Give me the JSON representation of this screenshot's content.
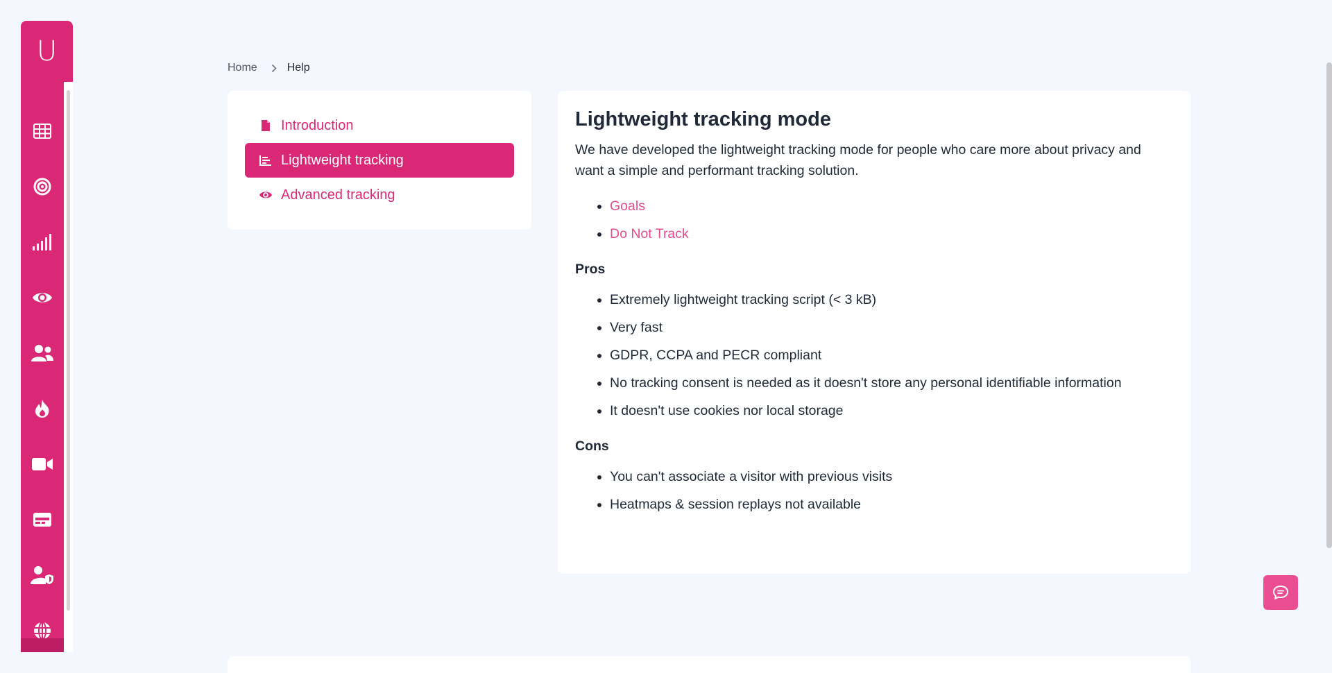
{
  "sidebar": {
    "logo_letter": "U",
    "items": [
      {
        "icon": "grid-icon"
      },
      {
        "icon": "target-icon"
      },
      {
        "icon": "signal-bars-icon"
      },
      {
        "icon": "eye-icon"
      },
      {
        "icon": "users-icon"
      },
      {
        "icon": "fire-icon"
      },
      {
        "icon": "video-camera-icon"
      },
      {
        "icon": "card-icon"
      },
      {
        "icon": "user-shield-icon"
      },
      {
        "icon": "globe-icon"
      }
    ]
  },
  "breadcrumb": {
    "home": "Home",
    "current": "Help"
  },
  "help_nav": {
    "items": [
      {
        "label": "Introduction",
        "icon": "file-icon",
        "active": false
      },
      {
        "label": "Lightweight tracking",
        "icon": "chart-icon",
        "active": true
      },
      {
        "label": "Advanced tracking",
        "icon": "eye-icon",
        "active": false
      }
    ]
  },
  "content": {
    "title": "Lightweight tracking mode",
    "intro": "We have developed the lightweight tracking mode for people who care more about privacy and want a simple and performant tracking solution.",
    "links": [
      "Goals",
      "Do Not Track"
    ],
    "pros_heading": "Pros",
    "pros": [
      "Extremely lightweight tracking script (< 3 kB)",
      "Very fast",
      "GDPR, CCPA and PECR compliant",
      "No tracking consent is needed as it doesn't store any personal identifiable information",
      "It doesn't use cookies nor local storage"
    ],
    "cons_heading": "Cons",
    "cons": [
      "You can't associate a visitor with previous visits",
      "Heatmaps & session replays not available"
    ]
  },
  "colors": {
    "brand": "#da2877",
    "link": "#e54b8e",
    "background": "#f5f7fe",
    "chat_button": "#ea4d92"
  },
  "chat": {
    "icon": "chat-bubble-icon"
  }
}
